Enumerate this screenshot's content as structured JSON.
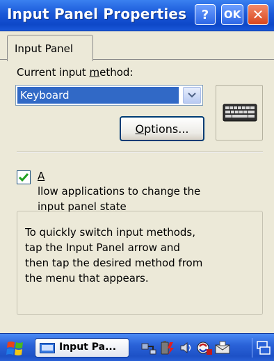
{
  "window": {
    "title": "Input Panel Properties",
    "help_label": "?",
    "ok_label": "OK",
    "close_label": "✕"
  },
  "tabs": [
    {
      "label": "Input Panel",
      "selected": true
    }
  ],
  "input_method": {
    "label_pre": "Current input ",
    "label_accel": "m",
    "label_post": "ethod:",
    "selected": "Keyboard",
    "icon": "keyboard-icon"
  },
  "options_button": {
    "accel": "O",
    "rest": "ptions..."
  },
  "allow_change": {
    "checked": true,
    "label_accel": "A",
    "line1_rest": "llow applications to change the",
    "line2": "input panel state"
  },
  "info": {
    "lines": [
      "To quickly switch input methods,",
      "tap the Input Panel arrow and",
      "then tap the desired method from",
      "the menu that appears."
    ]
  },
  "taskbar": {
    "start_icon": "windows-flag-icon",
    "task_label": "Input Pa...",
    "tray_icons": [
      "connectivity-icon",
      "battery-icon",
      "volume-icon",
      "sync-icon",
      "inbox-icon"
    ],
    "corner_icon": "input-panel-toggle-icon"
  },
  "colors": {
    "titlebar": "#1a58d8",
    "dialog_bg": "#ece9d8",
    "selection": "#3169c6",
    "close_button": "#d8461e"
  }
}
